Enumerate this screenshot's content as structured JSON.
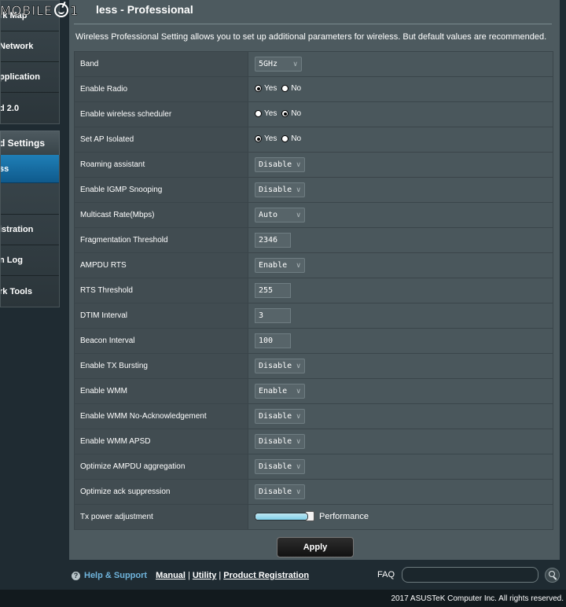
{
  "watermark": {
    "text_left": "MOBILE",
    "text_right": "1"
  },
  "sidebar": {
    "items_top": [
      "rk Map",
      "Network",
      "pplication",
      "d 2.0"
    ],
    "advanced_header": "d Settings",
    "active_item": "ss",
    "items_bottom": [
      "istration",
      "n Log",
      "rk Tools"
    ]
  },
  "header": {
    "title": "less - Professional",
    "description": "Wireless Professional Setting allows you to set up additional parameters for wireless. But default values are recommended."
  },
  "settings": [
    {
      "label": "Band",
      "type": "select",
      "value": "5GHz"
    },
    {
      "label": "Enable Radio",
      "type": "radio",
      "yes": "Yes",
      "no": "No",
      "selected": "Yes"
    },
    {
      "label": "Enable wireless scheduler",
      "type": "radio",
      "yes": "Yes",
      "no": "No",
      "selected": "No"
    },
    {
      "label": "Set AP Isolated",
      "type": "radio",
      "yes": "Yes",
      "no": "No",
      "selected": "Yes"
    },
    {
      "label": "Roaming assistant",
      "type": "select",
      "value": "Disable"
    },
    {
      "label": "Enable IGMP Snooping",
      "type": "select",
      "value": "Disable"
    },
    {
      "label": "Multicast Rate(Mbps)",
      "type": "select",
      "value": "Auto"
    },
    {
      "label": "Fragmentation Threshold",
      "type": "text",
      "value": "2346"
    },
    {
      "label": "AMPDU RTS",
      "type": "select",
      "value": "Enable"
    },
    {
      "label": "RTS Threshold",
      "type": "text",
      "value": "255"
    },
    {
      "label": "DTIM Interval",
      "type": "text",
      "value": "3"
    },
    {
      "label": "Beacon Interval",
      "type": "text",
      "value": "100"
    },
    {
      "label": "Enable TX Bursting",
      "type": "select",
      "value": "Disable"
    },
    {
      "label": "Enable WMM",
      "type": "select",
      "value": "Enable"
    },
    {
      "label": "Enable WMM No-Acknowledgement",
      "type": "select",
      "value": "Disable"
    },
    {
      "label": "Enable WMM APSD",
      "type": "select",
      "value": "Disable"
    },
    {
      "label": "Optimize AMPDU aggregation",
      "type": "select",
      "value": "Disable"
    },
    {
      "label": "Optimize ack suppression",
      "type": "select",
      "value": "Disable"
    },
    {
      "label": "Tx power adjustment",
      "type": "slider",
      "level": 1.0,
      "value_label": "Performance"
    }
  ],
  "apply_label": "Apply",
  "footer": {
    "help_title": "Help & Support",
    "links": [
      "Manual",
      "Utility",
      "Product Registration"
    ],
    "faq_label": "FAQ",
    "faq_placeholder": "",
    "copyright": "2017 ASUSTeK Computer Inc. All rights reserved."
  },
  "colors": {
    "accent": "#1f7fb7",
    "link": "#6fb4dc",
    "panel": "#4d5a5f",
    "background": "#1f2b32"
  },
  "icons": {
    "chevron": "chevron-down-icon",
    "help": "help-icon",
    "search": "search-icon"
  }
}
